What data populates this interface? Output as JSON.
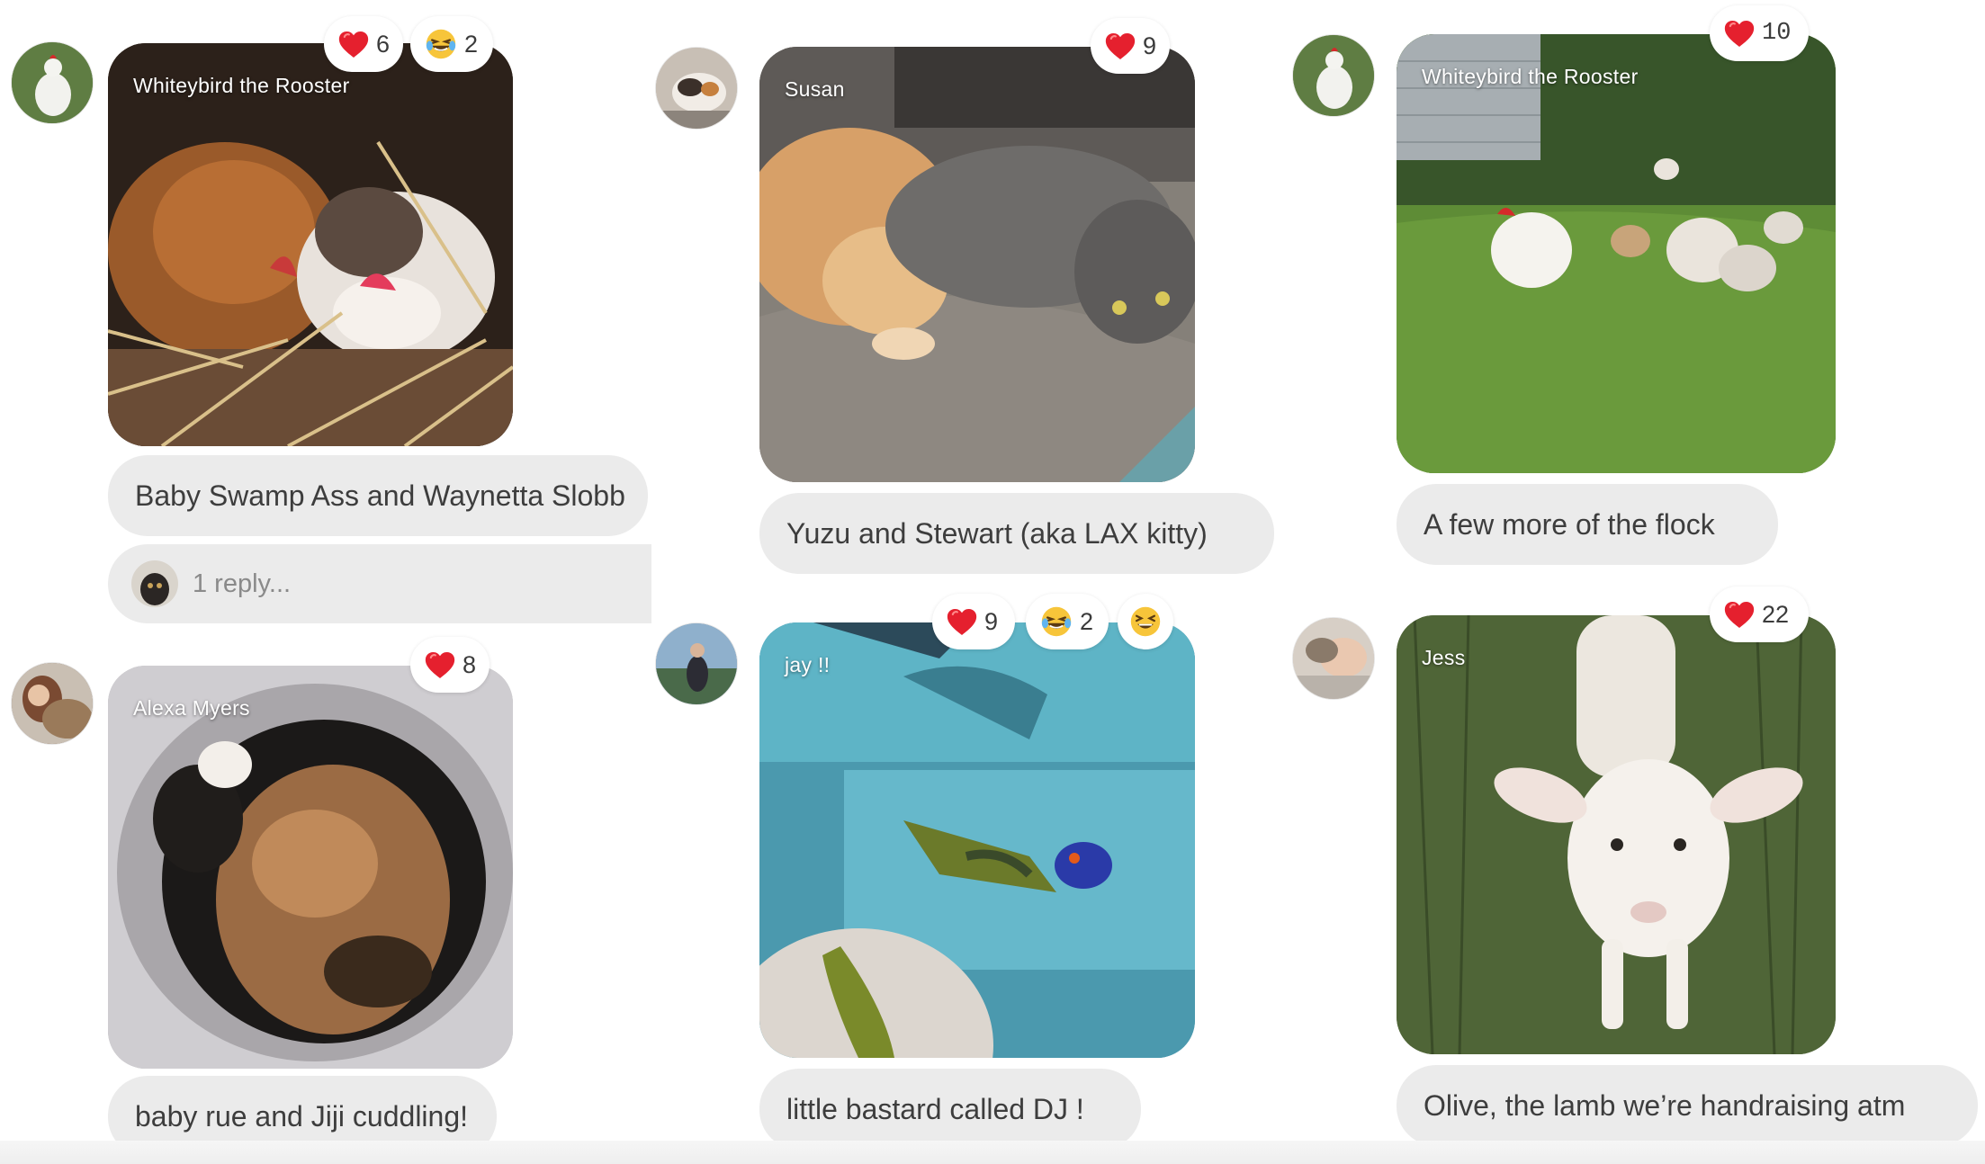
{
  "colors": {
    "bubble_bg": "#ebebeb",
    "caption_text": "#3d3d3d",
    "reply_text": "#8a8a8a",
    "heart": "#e5202e"
  },
  "posts": [
    {
      "sender": "Whiteybird the Rooster",
      "caption": "Baby Swamp Ass and Waynetta Slobb",
      "reactions": [
        {
          "icon": "heart",
          "count": "6"
        },
        {
          "icon": "laughing-tears",
          "count": "2"
        }
      ],
      "reply_text": "1 reply..."
    },
    {
      "sender": "Susan",
      "caption": "Yuzu and Stewart (aka LAX kitty)",
      "reactions": [
        {
          "icon": "heart",
          "count": "9"
        }
      ]
    },
    {
      "sender": "Whiteybird the Rooster",
      "caption": "A few more of the flock",
      "reactions": [
        {
          "icon": "heart",
          "count": "10"
        }
      ]
    },
    {
      "sender": "Alexa Myers",
      "caption": "baby rue and Jiji cuddling!",
      "reactions": [
        {
          "icon": "heart",
          "count": "8"
        }
      ]
    },
    {
      "sender": "jay !!",
      "caption": "little bastard called DJ !",
      "reactions": [
        {
          "icon": "heart",
          "count": "9"
        },
        {
          "icon": "laughing-tears",
          "count": "2"
        },
        {
          "icon": "grinning-squint",
          "count": ""
        }
      ]
    },
    {
      "sender": "Jess",
      "caption": "Olive, the lamb we’re handraising atm",
      "reactions": [
        {
          "icon": "heart",
          "count": "22"
        }
      ]
    }
  ]
}
